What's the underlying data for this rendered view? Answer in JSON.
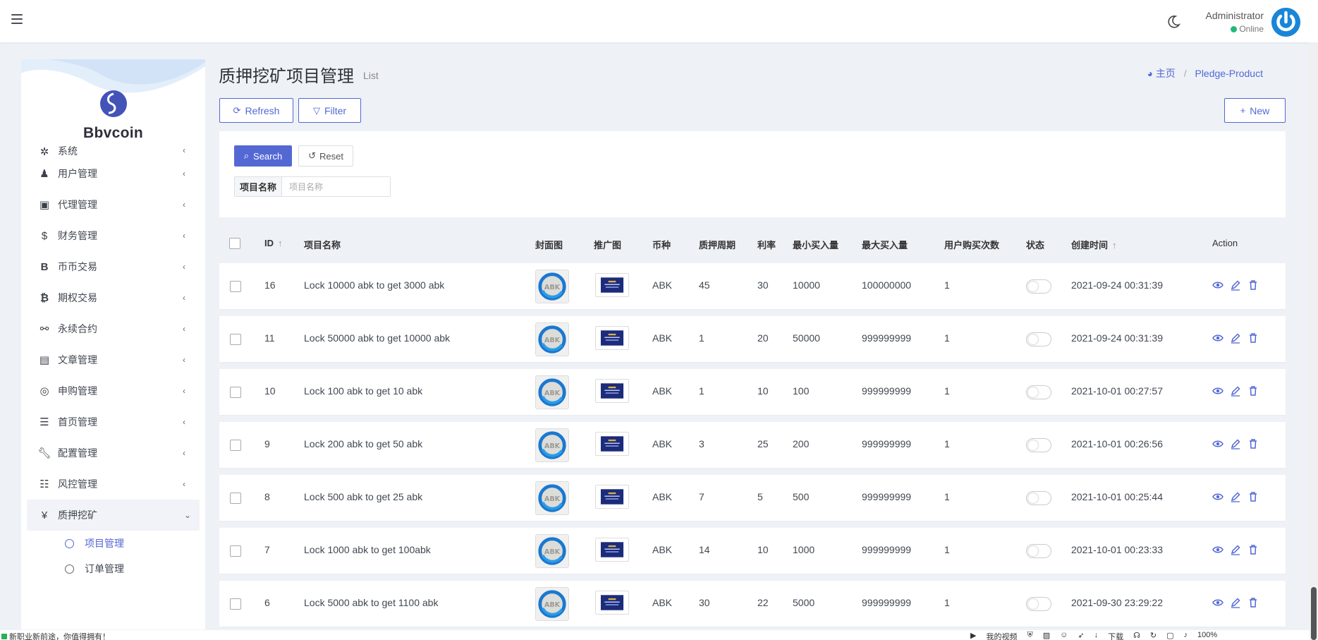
{
  "topbar": {
    "user_name": "Administrator",
    "user_status": "Online"
  },
  "sidebar": {
    "brand": "Bbvcoin",
    "partial_item": "系统",
    "items": [
      {
        "label": "用户管理",
        "icon": "users-icon"
      },
      {
        "label": "代理管理",
        "icon": "id-card-icon"
      },
      {
        "label": "财务管理",
        "icon": "dollar-icon"
      },
      {
        "label": "币币交易",
        "icon": "b-letter-icon"
      },
      {
        "label": "期权交易",
        "icon": "bitcoin-icon"
      },
      {
        "label": "永续合约",
        "icon": "link-icon"
      },
      {
        "label": "文章管理",
        "icon": "newspaper-icon"
      },
      {
        "label": "申购管理",
        "icon": "lifebuoy-icon"
      },
      {
        "label": "首页管理",
        "icon": "list-icon"
      },
      {
        "label": "配置管理",
        "icon": "wrench-icon"
      },
      {
        "label": "风控管理",
        "icon": "indent-icon"
      }
    ],
    "active_item": {
      "label": "质押挖矿",
      "icon": "yen-icon"
    },
    "submenu": [
      {
        "label": "项目管理",
        "current": true
      },
      {
        "label": "订单管理",
        "current": false
      }
    ]
  },
  "header": {
    "title": "质押挖矿项目管理",
    "subtitle": "List",
    "breadcrumb_home": "主页",
    "breadcrumb_current": "Pledge-Product"
  },
  "toolbar": {
    "refresh_label": "Refresh",
    "filter_label": "Filter",
    "new_label": "New"
  },
  "filter": {
    "search_label": "Search",
    "reset_label": "Reset",
    "field_label": "项目名称",
    "field_placeholder": "项目名称",
    "field_value": ""
  },
  "table": {
    "columns": {
      "id": "ID",
      "name": "项目名称",
      "cover": "封面图",
      "promo": "推广图",
      "currency": "币种",
      "period": "质押周期",
      "rate": "利率",
      "min_buy": "最小买入量",
      "max_buy": "最大买入量",
      "user_buy_times": "用户购买次数",
      "status": "状态",
      "created_at": "创建时间",
      "action": "Action"
    },
    "rows": [
      {
        "id": "16",
        "name": "Lock 10000 abk to get 3000 abk",
        "currency": "ABK",
        "period": "45",
        "rate": "30",
        "min_buy": "10000",
        "max_buy": "100000000",
        "user_buy_times": "1",
        "created_at": "2021-09-24 00:31:39"
      },
      {
        "id": "11",
        "name": "Lock 50000 abk to get 10000 abk",
        "currency": "ABK",
        "period": "1",
        "rate": "20",
        "min_buy": "50000",
        "max_buy": "999999999",
        "user_buy_times": "1",
        "created_at": "2021-09-24 00:31:39"
      },
      {
        "id": "10",
        "name": "Lock 100 abk to get 10 abk",
        "currency": "ABK",
        "period": "1",
        "rate": "10",
        "min_buy": "100",
        "max_buy": "999999999",
        "user_buy_times": "1",
        "created_at": "2021-10-01 00:27:57"
      },
      {
        "id": "9",
        "name": "Lock 200 abk to get 50 abk",
        "currency": "ABK",
        "period": "3",
        "rate": "25",
        "min_buy": "200",
        "max_buy": "999999999",
        "user_buy_times": "1",
        "created_at": "2021-10-01 00:26:56"
      },
      {
        "id": "8",
        "name": "Lock 500 abk to get 25 abk",
        "currency": "ABK",
        "period": "7",
        "rate": "5",
        "min_buy": "500",
        "max_buy": "999999999",
        "user_buy_times": "1",
        "created_at": "2021-10-01 00:25:44"
      },
      {
        "id": "7",
        "name": "Lock 1000 abk to get 100abk",
        "currency": "ABK",
        "period": "14",
        "rate": "10",
        "min_buy": "1000",
        "max_buy": "999999999",
        "user_buy_times": "1",
        "created_at": "2021-10-01 00:23:33"
      },
      {
        "id": "6",
        "name": "Lock 5000 abk to get 1100 abk",
        "currency": "ABK",
        "period": "30",
        "rate": "22",
        "min_buy": "5000",
        "max_buy": "999999999",
        "user_buy_times": "1",
        "created_at": "2021-09-30 23:29:22"
      }
    ],
    "cover_text": "ABK"
  },
  "statusbar": {
    "left_text": "新职业新前途，你值得拥有！",
    "right_items": [
      "我的视频",
      "下载",
      "100%"
    ]
  },
  "colors": {
    "accent": "#5468d4",
    "online": "#21b978",
    "avatar": "#1886d8"
  }
}
